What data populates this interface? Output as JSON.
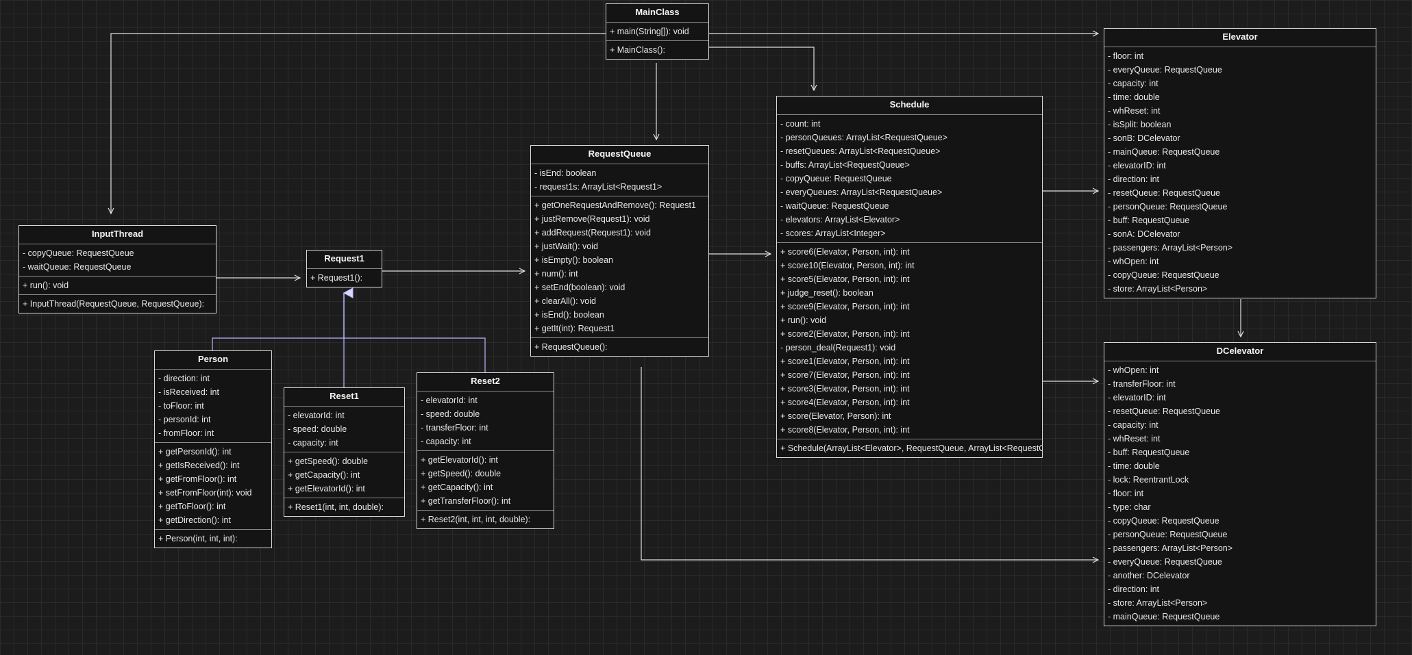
{
  "classes": [
    {
      "id": "MainClass",
      "name": "MainClass",
      "sections": [
        [
          "+ main(String[]): void"
        ],
        [
          "+ MainClass():"
        ]
      ]
    },
    {
      "id": "InputThread",
      "name": "InputThread",
      "sections": [
        [
          "- copyQueue: RequestQueue",
          "- waitQueue: RequestQueue"
        ],
        [
          "+ run(): void"
        ],
        [
          "+ InputThread(RequestQueue, RequestQueue):"
        ]
      ]
    },
    {
      "id": "Request1",
      "name": "Request1",
      "sections": [
        [
          "+ Request1():"
        ]
      ]
    },
    {
      "id": "Person",
      "name": "Person",
      "sections": [
        [
          "- direction: int",
          "- isReceived: int",
          "- toFloor: int",
          "- personId: int",
          "- fromFloor: int"
        ],
        [
          "+ getPersonId(): int",
          "+ getIsReceived(): int",
          "+ getFromFloor(): int",
          "+ setFromFloor(int): void",
          "+ getToFloor(): int",
          "+ getDirection(): int"
        ],
        [
          "+ Person(int, int, int):"
        ]
      ]
    },
    {
      "id": "Reset1",
      "name": "Reset1",
      "sections": [
        [
          "- elevatorId: int",
          "- speed: double",
          "- capacity: int"
        ],
        [
          "+ getSpeed(): double",
          "+ getCapacity(): int",
          "+ getElevatorId(): int"
        ],
        [
          "+ Reset1(int, int, double):"
        ]
      ]
    },
    {
      "id": "Reset2",
      "name": "Reset2",
      "sections": [
        [
          "- elevatorId: int",
          "- speed: double",
          "- transferFloor: int",
          "- capacity: int"
        ],
        [
          "+ getElevatorId(): int",
          "+ getSpeed(): double",
          "+ getCapacity(): int",
          "+ getTransferFloor(): int"
        ],
        [
          "+ Reset2(int, int, int, double):"
        ]
      ]
    },
    {
      "id": "RequestQueue",
      "name": "RequestQueue",
      "sections": [
        [
          "- isEnd: boolean",
          "- request1s: ArrayList<Request1>"
        ],
        [
          "+ getOneRequestAndRemove(): Request1",
          "+ justRemove(Request1): void",
          "+ addRequest(Request1): void",
          "+ justWait(): void",
          "+ isEmpty(): boolean",
          "+ num(): int",
          "+ setEnd(boolean): void",
          "+ clearAll(): void",
          "+ isEnd(): boolean",
          "+ getIt(int): Request1"
        ],
        [
          "+ RequestQueue():"
        ]
      ]
    },
    {
      "id": "Schedule",
      "name": "Schedule",
      "sections": [
        [
          "- count: int",
          "- personQueues: ArrayList<RequestQueue>",
          "- resetQueues: ArrayList<RequestQueue>",
          "- buffs: ArrayList<RequestQueue>",
          "- copyQueue: RequestQueue",
          "- everyQueues: ArrayList<RequestQueue>",
          "- waitQueue: RequestQueue",
          "- elevators: ArrayList<Elevator>",
          "- scores: ArrayList<Integer>"
        ],
        [
          "+ score6(Elevator, Person, int): int",
          "+ score10(Elevator, Person, int): int",
          "+ score5(Elevator, Person, int): int",
          "+ judge_reset(): boolean",
          "+ score9(Elevator, Person, int): int",
          "+ run(): void",
          "+ score2(Elevator, Person, int): int",
          "- person_deal(Request1): void",
          "+ score1(Elevator, Person, int): int",
          "+ score7(Elevator, Person, int): int",
          "+ score3(Elevator, Person, int): int",
          "+ score4(Elevator, Person, int): int",
          "+ score(Elevator, Person): int",
          "+ score8(Elevator, Person, int): int"
        ],
        [
          "+ Schedule(ArrayList<Elevator>, RequestQueue, ArrayList<RequestQueue>"
        ]
      ]
    },
    {
      "id": "Elevator",
      "name": "Elevator",
      "sections": [
        [
          "- floor: int",
          "- everyQueue: RequestQueue",
          "- capacity: int",
          "- time: double",
          "- whReset: int",
          "- isSplit: boolean",
          "- sonB: DCelevator",
          "- mainQueue: RequestQueue",
          "- elevatorID: int",
          "- direction: int",
          "- resetQueue: RequestQueue",
          "- personQueue: RequestQueue",
          "- buff: RequestQueue",
          "- sonA: DCelevator",
          "- passengers: ArrayList<Person>",
          "- whOpen: int",
          "- copyQueue: RequestQueue",
          "- store: ArrayList<Person>"
        ]
      ]
    },
    {
      "id": "DCelevator",
      "name": "DCelevator",
      "sections": [
        [
          "- whOpen: int",
          "- transferFloor: int",
          "- elevatorID: int",
          "- resetQueue: RequestQueue",
          "- capacity: int",
          "- whReset: int",
          "- buff: RequestQueue",
          "- time: double",
          "- lock: ReentrantLock",
          "- floor: int",
          "- type: char",
          "- copyQueue: RequestQueue",
          "- personQueue: RequestQueue",
          "- passengers: ArrayList<Person>",
          "- everyQueue: RequestQueue",
          "- another: DCelevator",
          "- direction: int",
          "- store: ArrayList<Person>",
          "- mainQueue: RequestQueue"
        ]
      ]
    }
  ],
  "relations": [
    {
      "type": "association",
      "from": "MainClass",
      "to": "InputThread"
    },
    {
      "type": "association",
      "from": "MainClass",
      "to": "Elevator"
    },
    {
      "type": "association",
      "from": "MainClass",
      "to": "Schedule"
    },
    {
      "type": "association",
      "from": "MainClass",
      "to": "RequestQueue"
    },
    {
      "type": "association",
      "from": "InputThread",
      "to": "Request1"
    },
    {
      "type": "association",
      "from": "Request1",
      "to": "RequestQueue"
    },
    {
      "type": "association",
      "from": "RequestQueue",
      "to": "Schedule"
    },
    {
      "type": "association",
      "from": "RequestQueue",
      "to": "DCelevator"
    },
    {
      "type": "association",
      "from": "Schedule",
      "to": "Elevator"
    },
    {
      "type": "association",
      "from": "Schedule",
      "to": "DCelevator"
    },
    {
      "type": "association",
      "from": "Elevator",
      "to": "DCelevator"
    },
    {
      "type": "inheritance",
      "from": "Person",
      "to": "Request1"
    },
    {
      "type": "inheritance",
      "from": "Reset1",
      "to": "Request1"
    },
    {
      "type": "inheritance",
      "from": "Reset2",
      "to": "Request1"
    }
  ],
  "colors": {
    "background": "#1c1c1c",
    "grid": "#2a2a2a",
    "box_border": "#d9d9d9",
    "box_fill": "#141414",
    "edge": "#e0e0e0",
    "inheritance_edge": "#b8b8ff"
  }
}
